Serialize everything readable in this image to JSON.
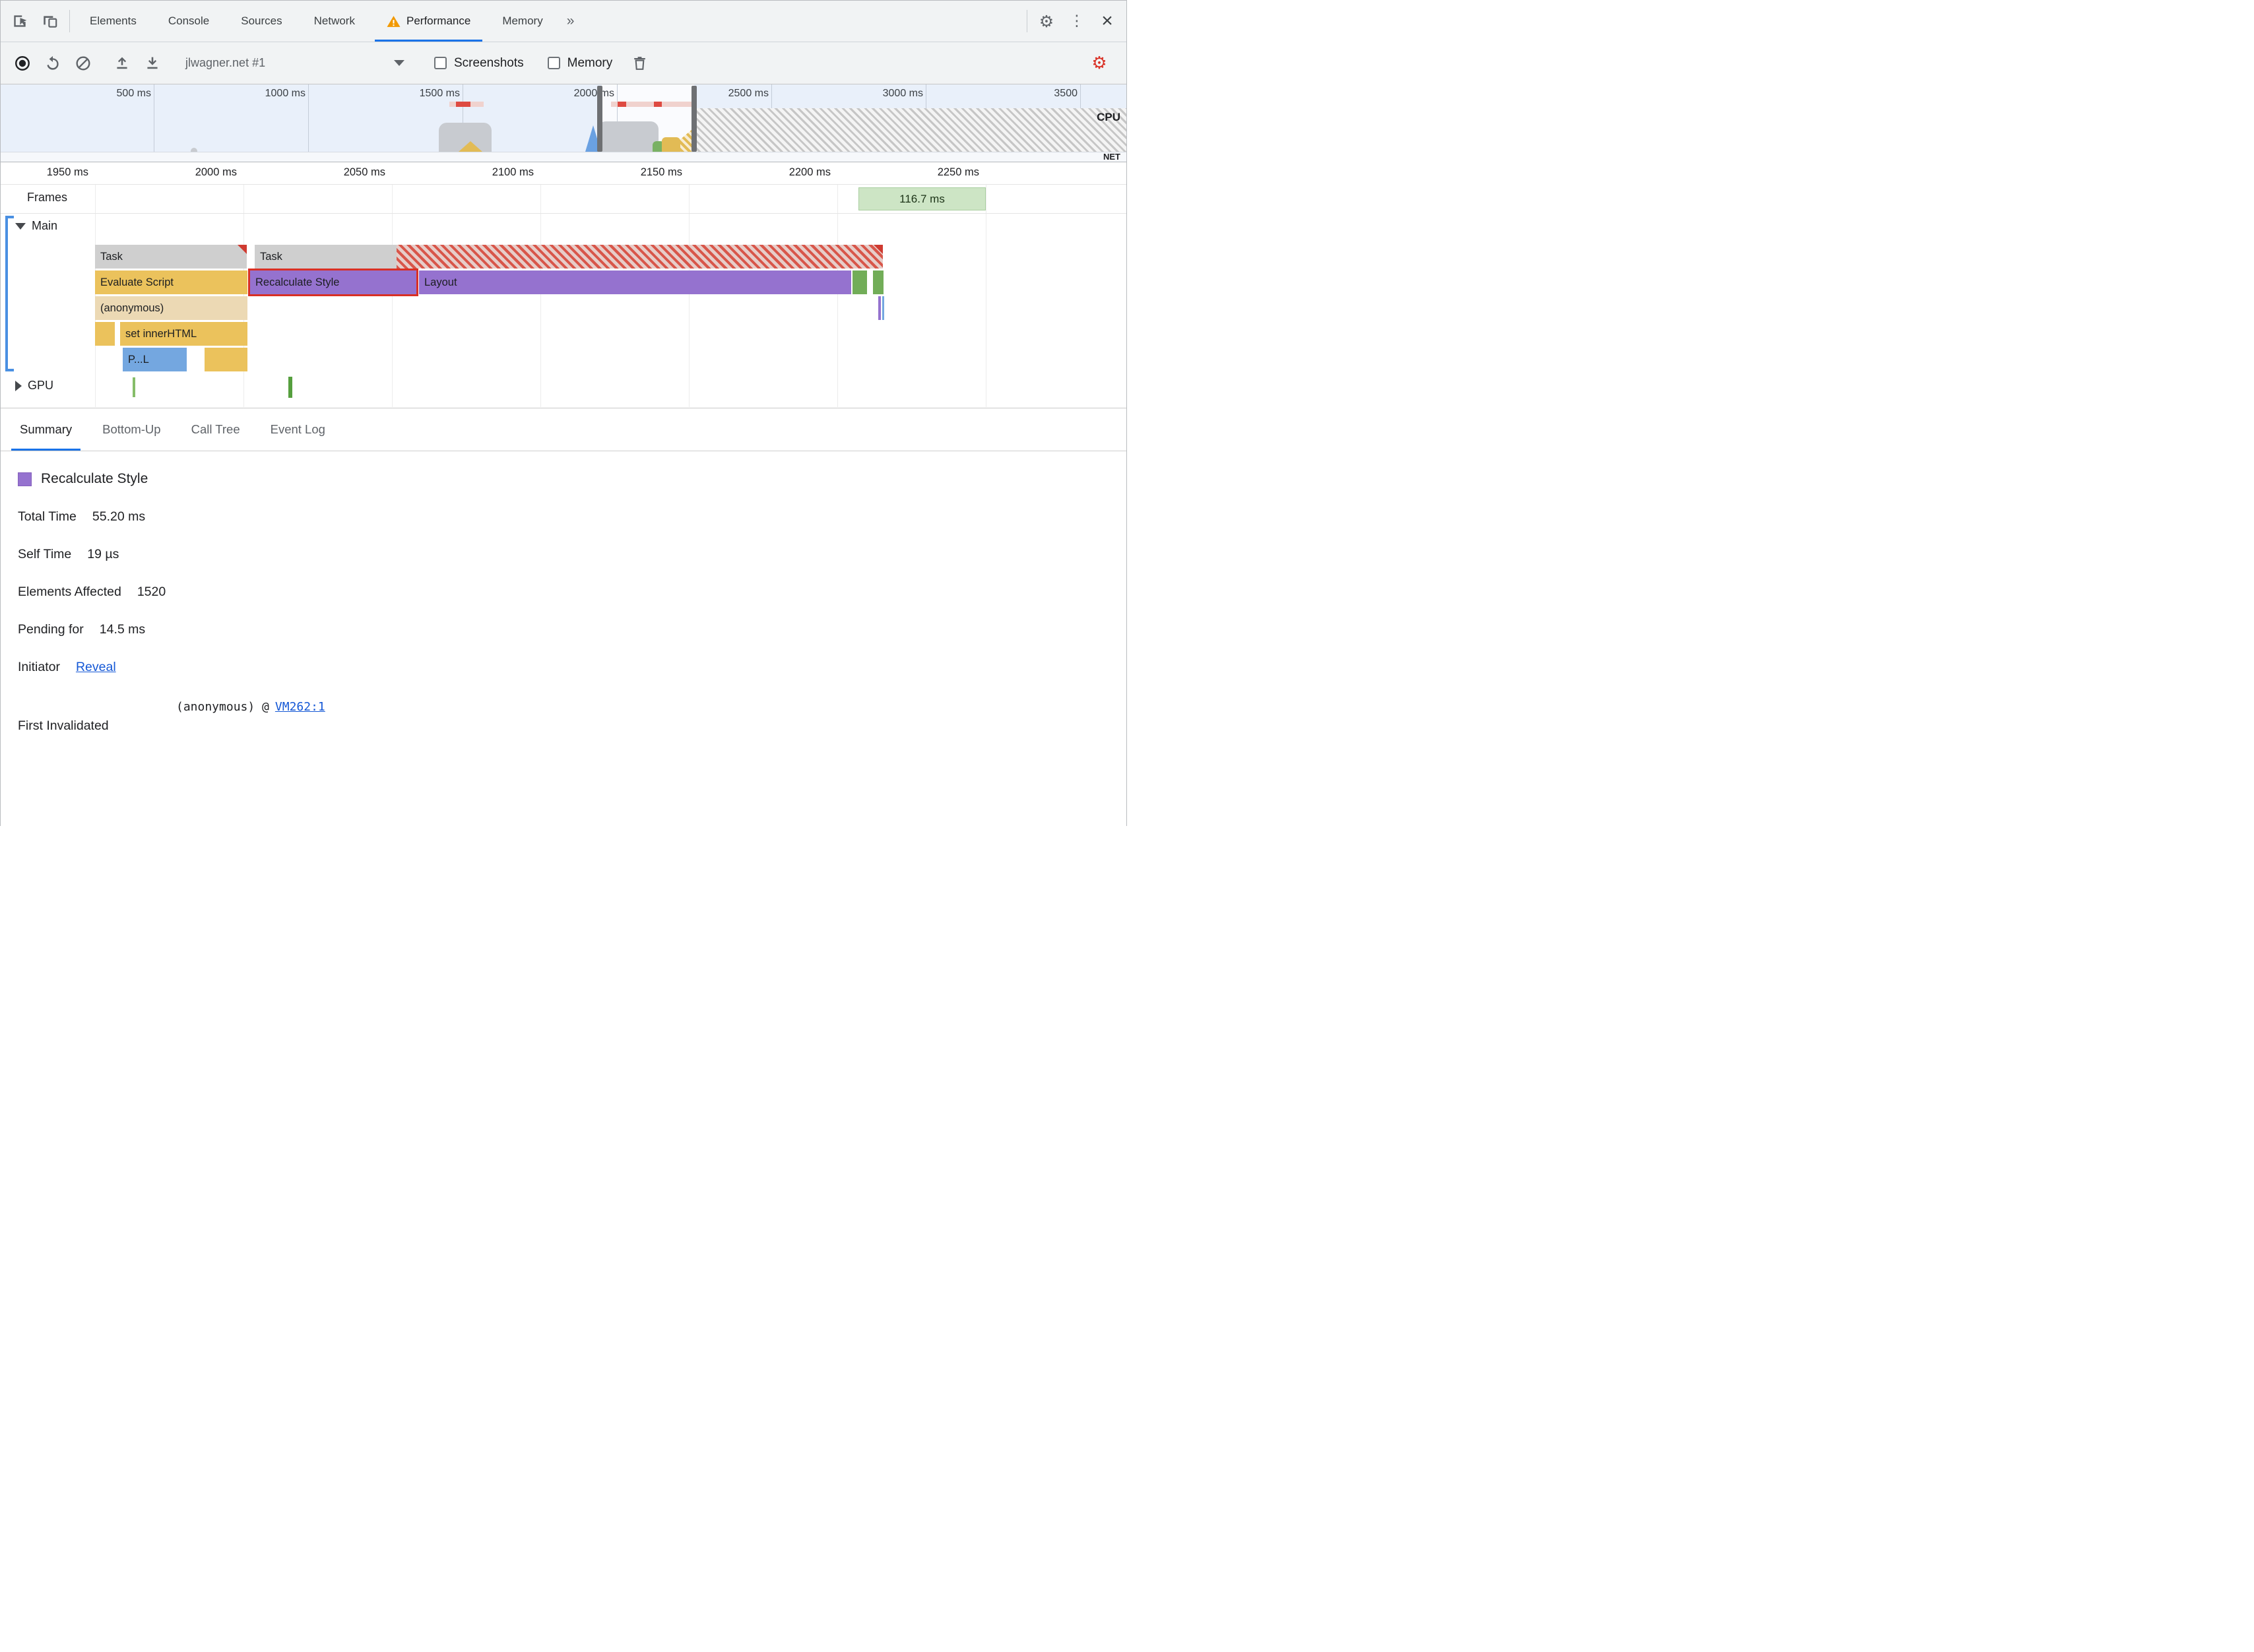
{
  "main_toolbar": {
    "tabs": [
      "Elements",
      "Console",
      "Sources",
      "Network",
      "Performance",
      "Memory"
    ],
    "more_tabs": "»"
  },
  "icons": {
    "settings_gear": "⚙",
    "capture_gear": "⚙",
    "kebab": "⋮",
    "close": "×"
  },
  "perf_toolbar": {
    "history_selector": "jlwagner.net #1",
    "screenshots_label": "Screenshots",
    "memory_label": "Memory"
  },
  "overview": {
    "time_labels": [
      "500 ms",
      "1000 ms",
      "1500 ms",
      "2000 ms",
      "2500 ms",
      "3000 ms",
      "3500"
    ],
    "cpu_label": "CPU",
    "net_label": "NET"
  },
  "timeline": {
    "ruler_labels": [
      "1950 ms",
      "2000 ms",
      "2050 ms",
      "2100 ms",
      "2150 ms",
      "2200 ms",
      "2250 ms"
    ],
    "frames_label": "Frames",
    "frame_duration": "116.7 ms",
    "main_label": "Main",
    "gpu_label": "GPU",
    "bars": {
      "task": "Task",
      "evaluate_script": "Evaluate Script",
      "recalculate_style": "Recalculate Style",
      "layout": "Layout",
      "anonymous": "(anonymous)",
      "set_inner_html": "set innerHTML",
      "parse_html": "P...L"
    }
  },
  "bottom_tabs": [
    "Summary",
    "Bottom-Up",
    "Call Tree",
    "Event Log"
  ],
  "summary": {
    "title": "Recalculate Style",
    "rows": [
      {
        "label": "Total Time",
        "value": "55.20 ms"
      },
      {
        "label": "Self Time",
        "value": "19 µs"
      },
      {
        "label": "Elements Affected",
        "value": "1520"
      },
      {
        "label": "Pending for",
        "value": "14.5 ms"
      }
    ],
    "initiator_label": "Initiator",
    "initiator_link": "Reveal",
    "first_invalidated_label": "First Invalidated",
    "first_invalidated_fn": "(anonymous) @",
    "first_invalidated_link": "VM262:1"
  },
  "colors": {
    "accent_blue": "#1a73e8",
    "link_blue": "#1558d6",
    "task_gray": "#cfcfcf",
    "script_yellow": "#ebc25c",
    "style_purple": "#9572cf",
    "function_tan": "#ecd9b4",
    "parse_blue": "#74a7e0",
    "paint_green": "#72ad58",
    "long_task_red": "#cf3a30",
    "highlight_border_red": "#d93025",
    "warning_orange": "#f29900"
  }
}
